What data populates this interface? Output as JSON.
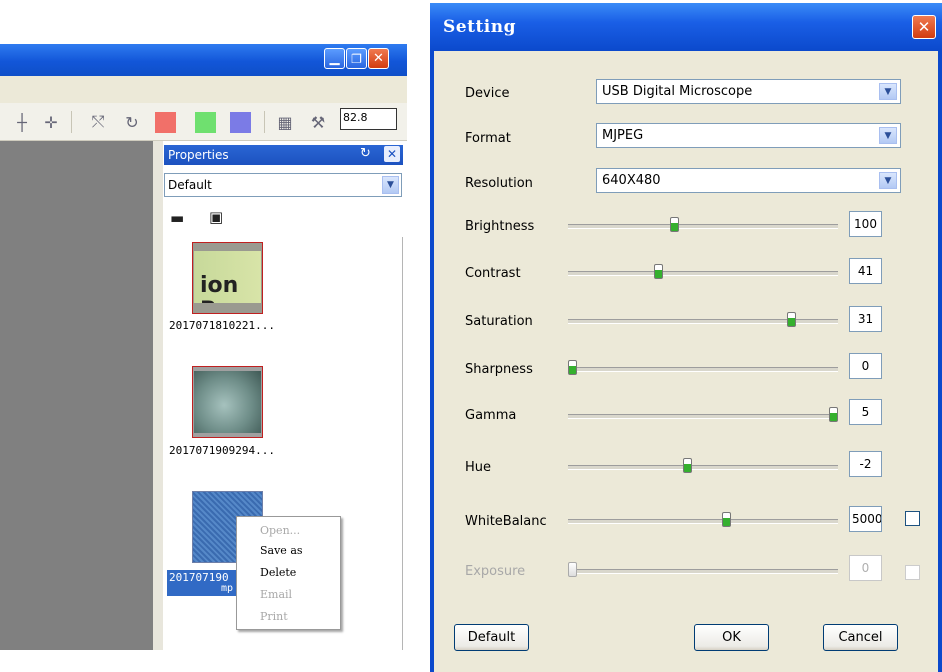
{
  "app_window": {
    "title_buttons": {
      "minimize_icon": "minimize-icon",
      "maximize_icon": "restore-icon",
      "close_icon": "close-icon"
    },
    "toolbar": {
      "icons": [
        "crosshair-icon",
        "move-crosshair-icon",
        "calibrate-icon",
        "rotate-icon",
        "grid-icon",
        "measure-tool-icon"
      ],
      "color_swatches": [
        "#f17069",
        "#6fe06f",
        "#7b7be6"
      ],
      "zoom_value": "82.8"
    },
    "properties_panel": {
      "title": "Properties",
      "select_value": "Default",
      "view_icons": [
        "image-view-icon",
        "video-view-icon"
      ],
      "thumbnails": [
        {
          "label": "2017071810221...",
          "image_text": "ion R"
        },
        {
          "label": "2017071909294..."
        },
        {
          "label_line1": "201707190",
          "label_line2": "mp"
        }
      ]
    },
    "context_menu": {
      "items": [
        {
          "label": "Open...",
          "enabled": false
        },
        {
          "label": "Save as",
          "enabled": true
        },
        {
          "label": "Delete",
          "enabled": true
        },
        {
          "label": "Email",
          "enabled": false
        },
        {
          "label": "Print",
          "enabled": false
        }
      ]
    }
  },
  "setting_dialog": {
    "title": "Setting",
    "close_icon": "close-icon",
    "device": {
      "label": "Device",
      "value": "USB Digital Microscope"
    },
    "format": {
      "label": "Format",
      "value": "MJPEG"
    },
    "resolution": {
      "label": "Resolution",
      "value": "640X480"
    },
    "sliders": {
      "brightness": {
        "label": "Brightness",
        "value": "100",
        "level": 0.39
      },
      "contrast": {
        "label": "Contrast",
        "value": "41",
        "level": 0.33
      },
      "saturation": {
        "label": "Saturation",
        "value": "31",
        "level": 0.84
      },
      "sharpness": {
        "label": "Sharpness",
        "value": "0",
        "level": 0.0
      },
      "gamma": {
        "label": "Gamma",
        "value": "5",
        "level": 1.0
      },
      "hue": {
        "label": "Hue",
        "value": "-2",
        "level": 0.44
      },
      "white_balance": {
        "label": "WhiteBalanc",
        "value": "5000",
        "level": 0.59,
        "auto_checked": false
      },
      "exposure": {
        "label": "Exposure",
        "value": "0",
        "level": 0.0,
        "enabled": false,
        "auto_checked": false
      }
    },
    "buttons": {
      "default": "Default",
      "ok": "OK",
      "cancel": "Cancel"
    },
    "colors": {
      "title_bar": "#1a5fe6",
      "dialog_bg": "#ece9d8",
      "slider_thumb": "#35b02e"
    }
  }
}
